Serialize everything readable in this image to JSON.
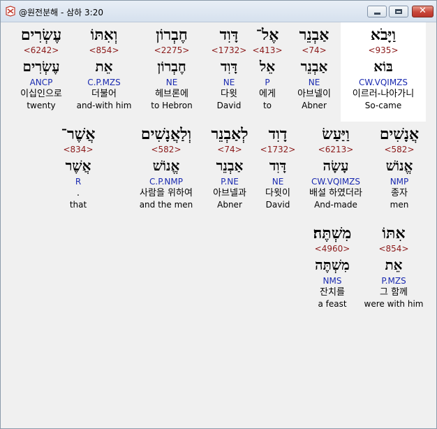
{
  "window": {
    "title": "@원전분해 - 삼하 3:20",
    "icons": {
      "app": "app-icon",
      "minimize": "minimize-icon",
      "maximize": "maximize-icon",
      "close": "close-icon"
    },
    "close_label": "✕"
  },
  "rows": [
    [
      {
        "hebrew": "וַיָּבֹא",
        "strong": "<935>",
        "lemma": "בּוֹא",
        "morph": "CW.VQIMZS",
        "korean": "이르러-나아가니",
        "english": "So-came",
        "highlight": true
      },
      {
        "hebrew": "אַבְנֵר",
        "strong": "<74>",
        "lemma": "אַבְנֵר",
        "morph": "NE",
        "korean": "아브넬이",
        "english": "Abner"
      },
      {
        "hebrew": "אֶל־",
        "strong": "<413>",
        "lemma": "אֵל",
        "morph": "P",
        "korean": "에게",
        "english": "to"
      },
      {
        "hebrew": "דָּוִד",
        "strong": "<1732>",
        "lemma": "דָּוִד",
        "morph": "NE",
        "korean": "다윗",
        "english": "David"
      },
      {
        "hebrew": "חֶבְרוֹן",
        "strong": "<2275>",
        "lemma": "חֶבְרוֹן",
        "morph": "NE",
        "korean": "헤브론에",
        "english": "to Hebron"
      },
      {
        "hebrew": "וְאִתּוֹ",
        "strong": "<854>",
        "lemma": "אֵת",
        "morph": "C.P.MZS",
        "korean": "더불어",
        "english": "and-with him"
      },
      {
        "hebrew": "עֶשְׂרִים",
        "strong": "<6242>",
        "lemma": "עֶשְׂרִים",
        "morph": "ANCP",
        "korean": "이십인으로",
        "english": "twenty"
      }
    ],
    [
      {
        "hebrew": "אֲנָשִׁים",
        "strong": "<582>",
        "lemma": "אֱנוֹשׁ",
        "morph": "NMP",
        "korean": "종자",
        "english": "men"
      },
      {
        "hebrew": "וַיַּעַשׂ",
        "strong": "<6213>",
        "lemma": "עָשָׂה",
        "morph": "CW.VQIMZS",
        "korean": "배설 하였더라",
        "english": "And-made"
      },
      {
        "hebrew": "דָוִד",
        "strong": "<1732>",
        "lemma": "דָּוִד",
        "morph": "NE",
        "korean": "다윗이",
        "english": "David"
      },
      {
        "hebrew": "לְאַבְנֵר",
        "strong": "<74>",
        "lemma": "אַבְנֵר",
        "morph": "P.NE",
        "korean": "아브넬과",
        "english": "Abner"
      },
      {
        "hebrew": "וְלַאֲנָשִׁים",
        "strong": "<582>",
        "lemma": "אֱנוֹשׁ",
        "morph": "C.P.NMP",
        "korean": "사람을 위하여",
        "english": "and the men"
      },
      {
        "hebrew": "אֲשֶׁר־",
        "strong": "<834>",
        "lemma": "אֲשֶׁר",
        "morph": "R",
        "korean": ".",
        "english": "that"
      }
    ],
    [
      {
        "hebrew": "אִתּוֹ",
        "strong": "<854>",
        "lemma": "אֵת",
        "morph": "P.MZS",
        "korean": "그 함께",
        "english": "were with him"
      },
      {
        "hebrew": "מִשְׁתֶּה׃",
        "strong": "<4960>",
        "lemma": "מִשְׁתֶּה",
        "morph": "NMS",
        "korean": "잔치를",
        "english": "a feast"
      }
    ]
  ]
}
